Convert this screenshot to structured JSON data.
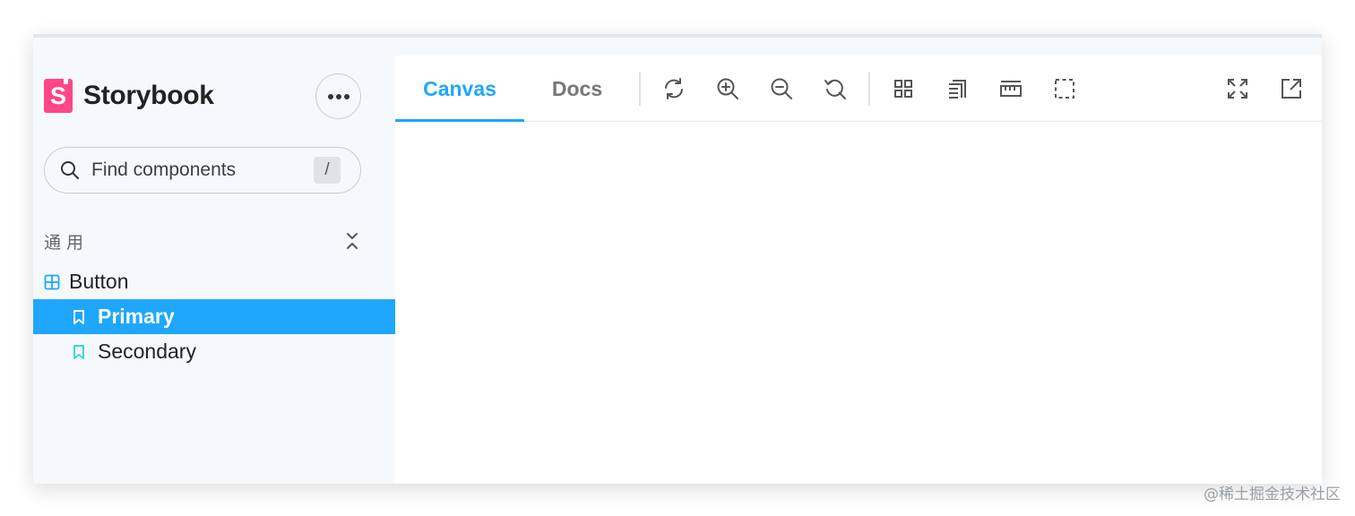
{
  "sidebar": {
    "brand": {
      "logo_letter": "S",
      "name": "Storybook"
    },
    "search": {
      "placeholder": "Find components",
      "shortcut": "/"
    },
    "group": {
      "label": "通用"
    },
    "tree": {
      "component": {
        "label": "Button"
      },
      "stories": [
        {
          "label": "Primary",
          "selected": true
        },
        {
          "label": "Secondary",
          "selected": false
        }
      ]
    }
  },
  "toolbar": {
    "tabs": [
      {
        "label": "Canvas",
        "active": true
      },
      {
        "label": "Docs",
        "active": false
      }
    ],
    "tools": [
      "remount-icon",
      "zoom-in-icon",
      "zoom-out-icon",
      "reset-zoom-icon",
      "grid-icon",
      "background-icon",
      "measure-icon",
      "outline-icon"
    ],
    "right_tools": [
      "fullscreen-icon",
      "open-new-tab-icon"
    ]
  },
  "colors": {
    "accent": "#1ea7fd",
    "brand": "#ff4785",
    "story_icon": "#37d5d3",
    "component_icon": "#1ea7fd"
  },
  "watermark": "@稀土掘金技术社区"
}
